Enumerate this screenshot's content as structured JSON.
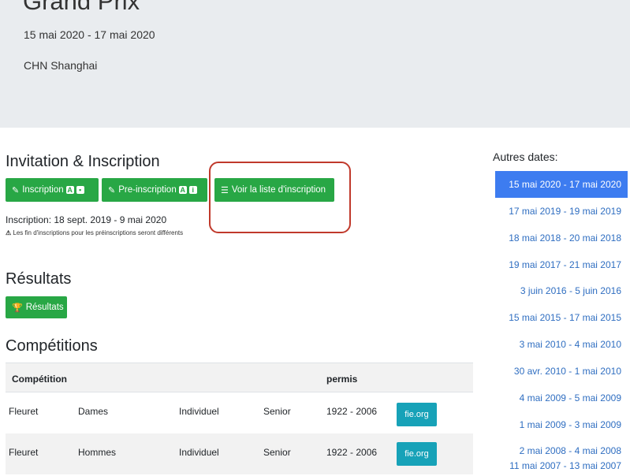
{
  "event": {
    "title": "Grand Prix",
    "dates": "15 mai 2020 - 17 mai 2020",
    "location": "CHN Shanghai"
  },
  "invitation": {
    "heading": "Invitation & Inscription",
    "inscription_label": "Inscription",
    "preinscription_label": "Pre-inscription",
    "voir_liste_label": "Voir la liste d'inscription",
    "badge_a": "A",
    "badge_lock": "🔒",
    "badge_i": "i",
    "period_text": "Inscription: 18 sept. 2019 - 9 mai 2020",
    "note_text": "Les fin d'inscriptions pour les préinscriptions seront différents"
  },
  "results": {
    "heading": "Résultats",
    "button_label": "Résultats"
  },
  "competitions": {
    "heading": "Compétitions",
    "columns": {
      "competition": "Compétition",
      "permis": "permis"
    },
    "rows": [
      {
        "weapon": "Fleuret",
        "gender": "Dames",
        "type": "Individuel",
        "category": "Senior",
        "permis": "1922 - 2006",
        "link": "fie.org"
      },
      {
        "weapon": "Fleuret",
        "gender": "Hommes",
        "type": "Individuel",
        "category": "Senior",
        "permis": "1922 - 2006",
        "link": "fie.org"
      }
    ]
  },
  "sidebar": {
    "title": "Autres dates:",
    "dates": [
      "15 mai 2020 - 17 mai 2020",
      "17 mai 2019 - 19 mai 2019",
      "18 mai 2018 - 20 mai 2018",
      "19 mai 2017 - 21 mai 2017",
      "3 juin 2016 - 5 juin 2016",
      "15 mai 2015 - 17 mai 2015",
      "3 mai 2010 - 4 mai 2010",
      "30 avr. 2010 - 1 mai 2010",
      "4 mai 2009 - 5 mai 2009",
      "1 mai 2009 - 3 mai 2009",
      "2 mai 2008 - 4 mai 2008",
      "11 mai 2007 - 13 mai 2007"
    ],
    "active_index": 0
  },
  "colors": {
    "primary_green": "#28a745",
    "info_teal": "#17a2b8",
    "active_blue": "#3d7cf0",
    "link_blue": "#2f6ec1",
    "highlight_red": "#c0392b"
  }
}
